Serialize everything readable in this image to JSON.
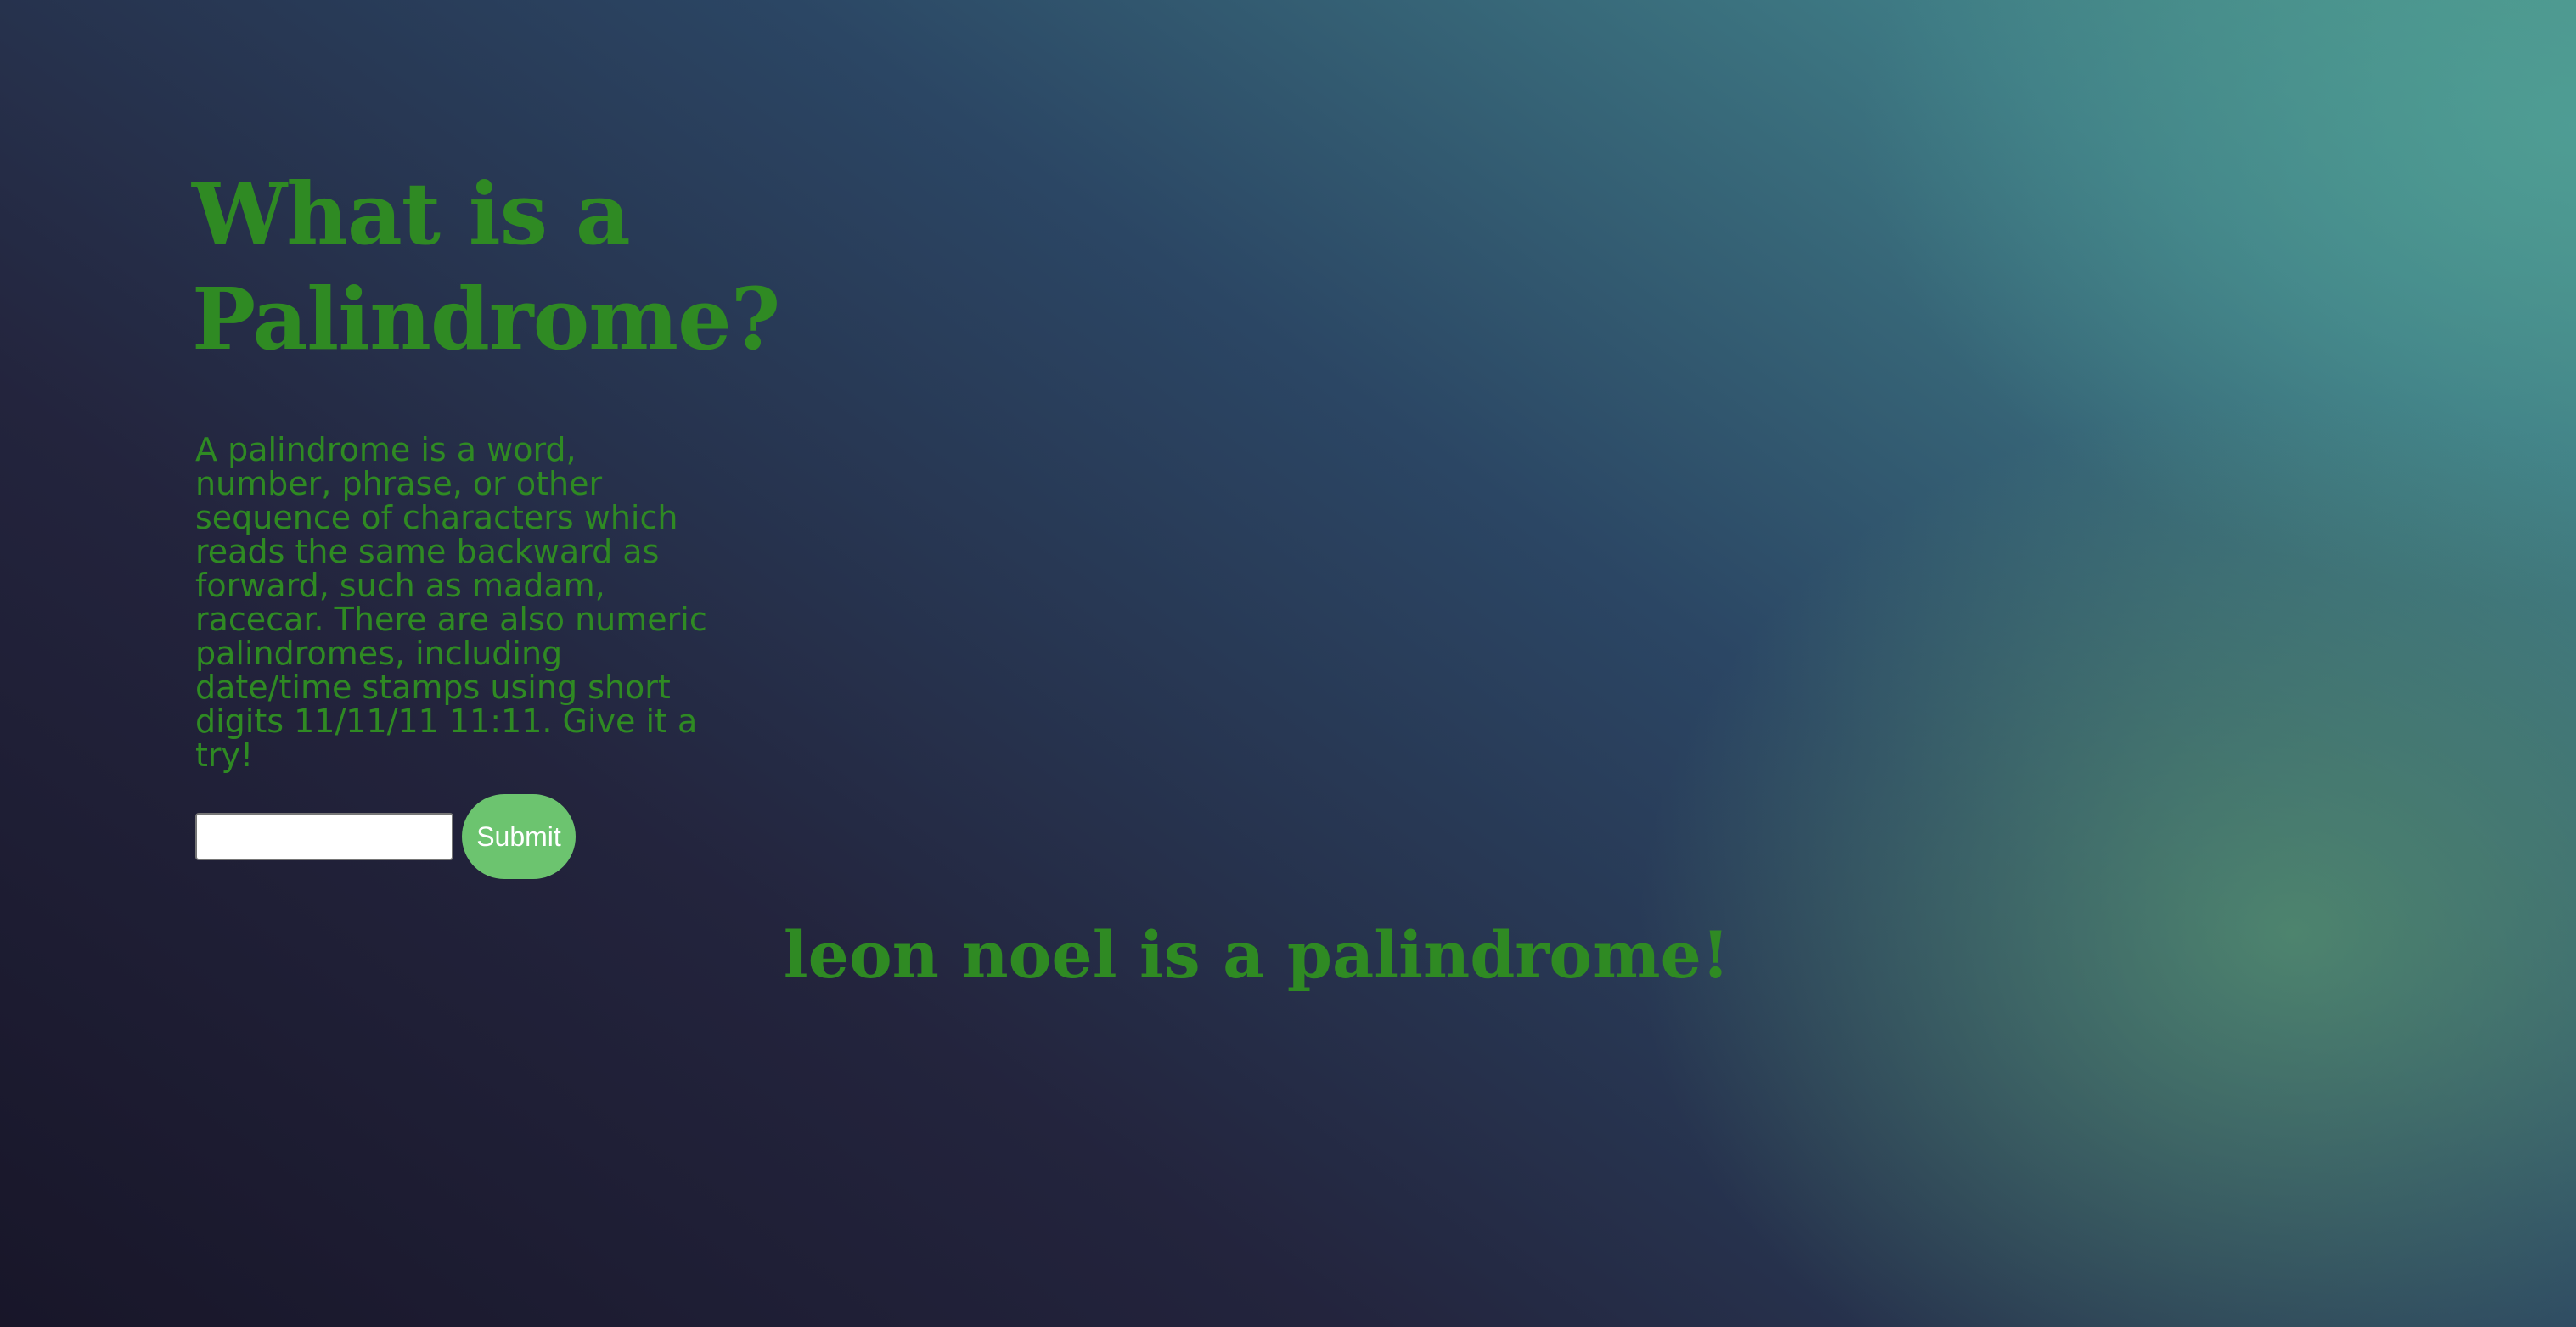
{
  "page": {
    "heading": "What is a Palindrome?",
    "description": "A palindrome is a word, number, phrase, or other sequence of characters which reads the same backward as forward, such as madam, racecar. There are also numeric palindromes, including date/time stamps using short digits 11/11/11 11:11. Give it a try!",
    "input": {
      "value": "",
      "placeholder": ""
    },
    "submit_label": "Submit",
    "result": "leon noel is a palindrome!"
  },
  "colors": {
    "text_green": "#2f8a23",
    "button_green": "#6cc46f",
    "button_text": "#ffffff",
    "background_dark": "#1a1a2e",
    "background_teal": "#4a9188"
  }
}
